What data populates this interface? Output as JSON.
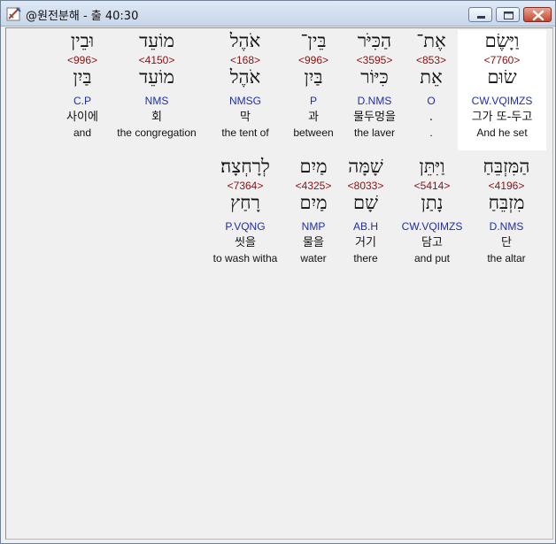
{
  "window": {
    "title": "@원전분해 - 출 40:30",
    "buttons": {
      "minimize": "minimize-icon",
      "maximize": "maximize-icon",
      "close": "close-icon"
    }
  },
  "colors": {
    "strong": "#8b1010",
    "morph": "#1f2ea8",
    "text": "#111111",
    "highlight": "#ffffff"
  },
  "verse": {
    "row1": [
      {
        "surface": "וַיָּשֶׂם",
        "strong": "<7760>",
        "lemma": "שׂוּם",
        "morph": "CW.VQIMZS",
        "korean": "그가 또-두고",
        "english": "And he set",
        "highlighted": true
      },
      {
        "surface": "אֶת־",
        "strong": "<853>",
        "lemma": "אֵת",
        "morph": "O",
        "korean": ".",
        "english": "."
      },
      {
        "surface": "הַכִּיֹּר",
        "strong": "<3595>",
        "lemma": "כִּיּוֹר",
        "morph": "D.NMS",
        "korean": "물두멍을",
        "english": "the laver"
      },
      {
        "surface": "בֵּין־",
        "strong": "<996>",
        "lemma": "בַּיִן",
        "morph": "P",
        "korean": "과",
        "english": "between"
      },
      {
        "surface": "אֹהֶל",
        "strong": "<168>",
        "lemma": "אֹהֶל",
        "morph": "NMSG",
        "korean": "막",
        "english": "the tent of"
      },
      {
        "surface": "מוֹעֵד",
        "strong": "<4150>",
        "lemma": "מוֹעֵד",
        "morph": "NMS",
        "korean": "회",
        "english": "the congregation"
      },
      {
        "surface": "וּבֵין",
        "strong": "<996>",
        "lemma": "בַּיִן",
        "morph": "C.P",
        "korean": "사이에",
        "english": "and"
      }
    ],
    "row2": [
      {
        "surface": "הַמִּזְבֵּחַ",
        "strong": "<4196>",
        "lemma": "מִזְבֵּחַ",
        "morph": "D.NMS",
        "korean": "단",
        "english": "the altar"
      },
      {
        "surface": "וַיִּתֵּן",
        "strong": "<5414>",
        "lemma": "נָתַן",
        "morph": "CW.VQIMZS",
        "korean": "담고",
        "english": "and put"
      },
      {
        "surface": "שָׁמָּה",
        "strong": "<8033>",
        "lemma": "שָׁם",
        "morph": "AB.H",
        "korean": "거기",
        "english": "there"
      },
      {
        "surface": "מַיִם",
        "strong": "<4325>",
        "lemma": "מַיִם",
        "morph": "NMP",
        "korean": "물을",
        "english": "water"
      },
      {
        "surface": "לְרָחְצָה׃",
        "strong": "<7364>",
        "lemma": "רָחַץ",
        "morph": "P.VQNG",
        "korean": "씻을",
        "english": "to wash witha"
      }
    ]
  }
}
